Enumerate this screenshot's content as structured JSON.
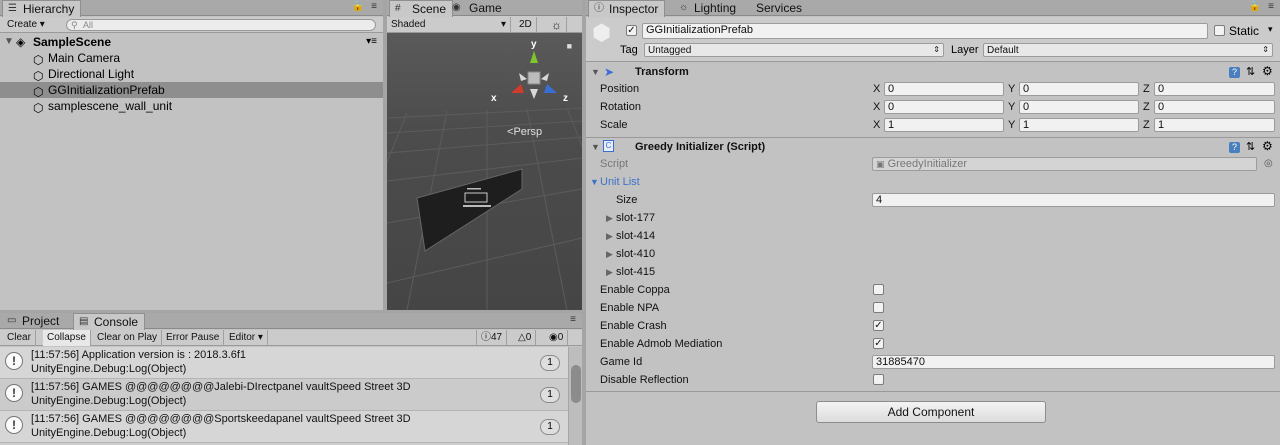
{
  "hierarchy": {
    "tab": "Hierarchy",
    "create": "Create",
    "search_placeholder": "All",
    "scene": "SampleScene",
    "items": [
      "Main Camera",
      "Directional Light",
      "GGInitializationPrefab",
      "samplescene_wall_unit"
    ],
    "selected": "GGInitializationPrefab"
  },
  "scene": {
    "tabs": [
      "Scene",
      "Game"
    ],
    "shading": "Shaded",
    "mode_2d": "2D",
    "persp": "Persp",
    "gizmo": {
      "x": "x",
      "y": "y",
      "z": "z"
    }
  },
  "console": {
    "tabs": [
      "Project",
      "Console"
    ],
    "buttons": [
      "Clear",
      "Collapse",
      "Clear on Play",
      "Error Pause",
      "Editor"
    ],
    "counts": {
      "info": "47",
      "warn": "0",
      "error": "0"
    },
    "entries": [
      {
        "line1": "[11:57:56] Application version is : 2018.3.6f1",
        "line2": "UnityEngine.Debug:Log(Object)",
        "count": "1"
      },
      {
        "line1": "[11:57:56] GAMES @@@@@@@@Jalebi-DIrectpanel vaultSpeed Street 3D",
        "line2": "UnityEngine.Debug:Log(Object)",
        "count": "1"
      },
      {
        "line1": "[11:57:56] GAMES @@@@@@@@Sportskeedapanel vaultSpeed Street 3D",
        "line2": "UnityEngine.Debug:Log(Object)",
        "count": "1"
      }
    ]
  },
  "inspector": {
    "tabs": [
      "Inspector",
      "Lighting",
      "Services"
    ],
    "object_name": "GGInitializationPrefab",
    "static_label": "Static",
    "tag_label": "Tag",
    "tag_value": "Untagged",
    "layer_label": "Layer",
    "layer_value": "Default",
    "transform": {
      "title": "Transform",
      "rows": [
        {
          "label": "Position",
          "x": "0",
          "y": "0",
          "z": "0"
        },
        {
          "label": "Rotation",
          "x": "0",
          "y": "0",
          "z": "0"
        },
        {
          "label": "Scale",
          "x": "1",
          "y": "1",
          "z": "1"
        }
      ]
    },
    "script_comp": {
      "title": "Greedy Initializer (Script)",
      "script_label": "Script",
      "script_value": "GreedyInitializer",
      "unit_list_label": "Unit List",
      "size_label": "Size",
      "size_value": "4",
      "slots": [
        "slot-177",
        "slot-414",
        "slot-410",
        "slot-415"
      ],
      "enable_coppa": "Enable Coppa",
      "enable_npa": "Enable NPA",
      "enable_crash": "Enable Crash",
      "enable_admob": "Enable Admob Mediation",
      "game_id_label": "Game Id",
      "game_id_value": "31885470",
      "disable_reflection": "Disable Reflection"
    },
    "add_component": "Add Component"
  },
  "colors": {
    "selection": "#8e8e8e",
    "panel": "#c2c2c2",
    "accent_blue": "#3d73c9"
  }
}
